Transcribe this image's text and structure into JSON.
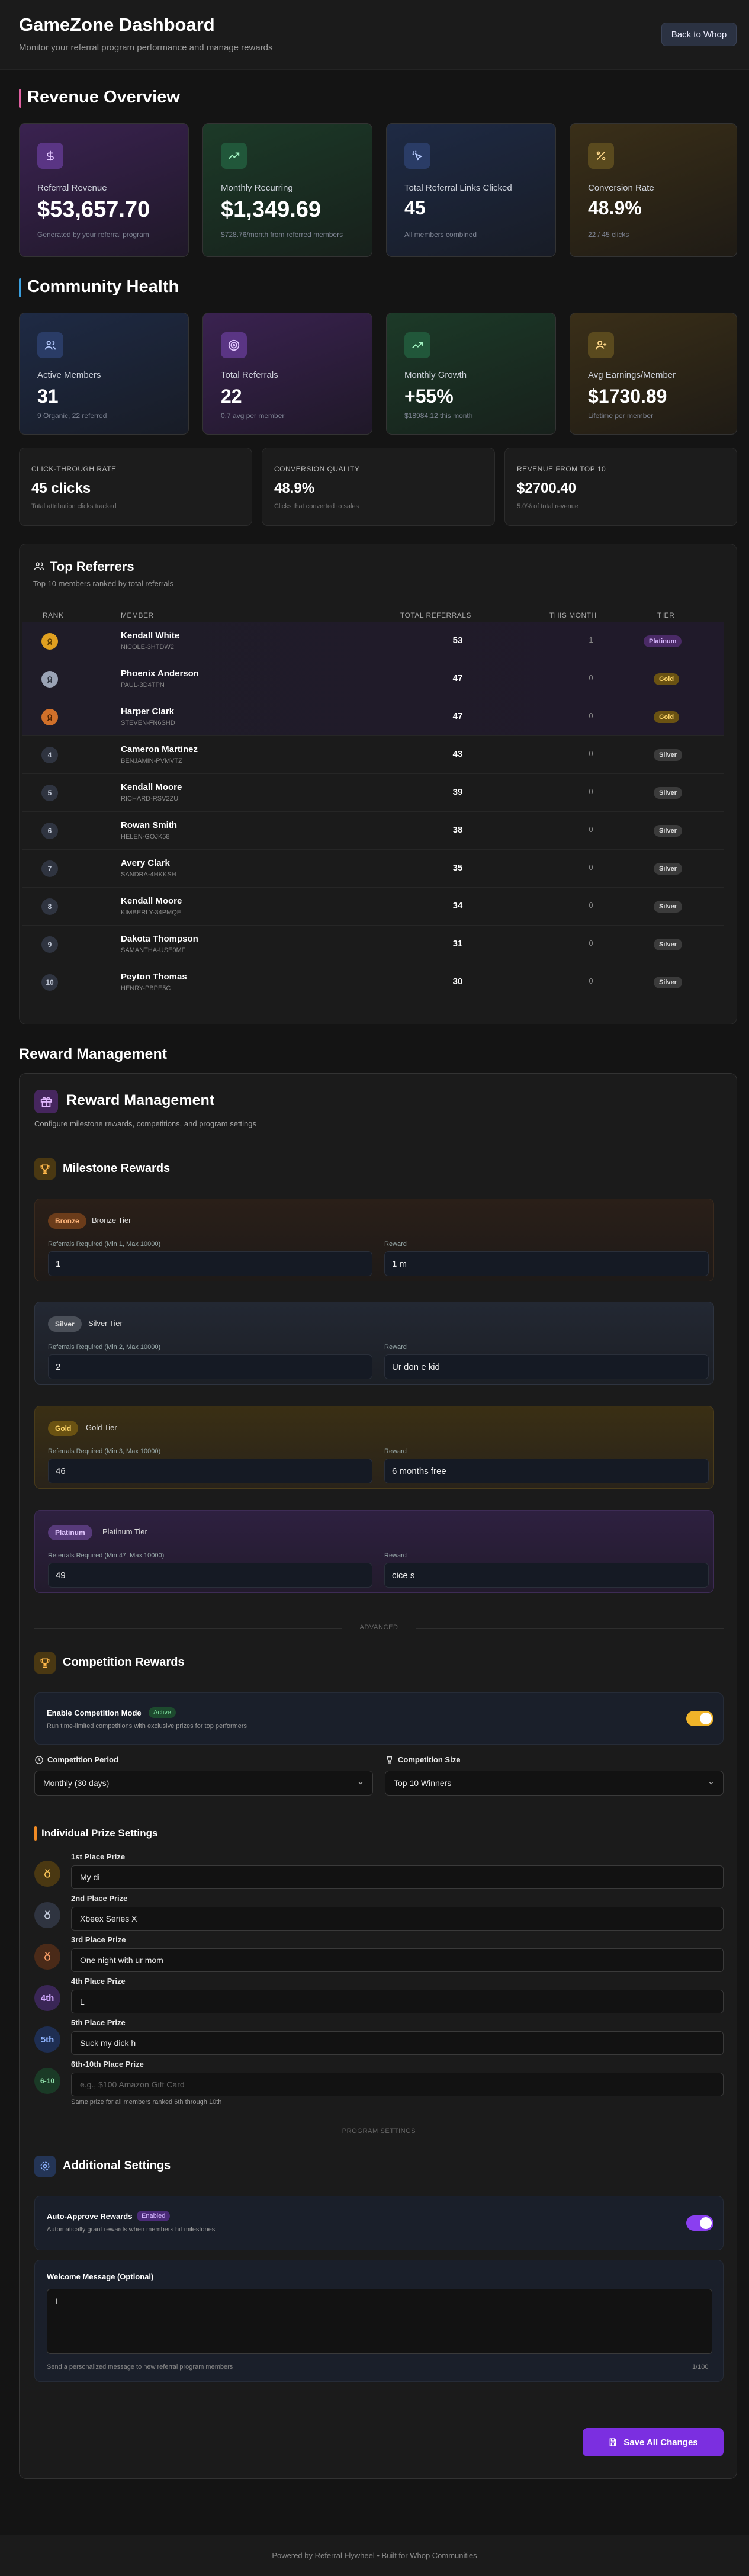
{
  "header": {
    "title": "GameZone Dashboard",
    "subtitle": "Monitor your referral program performance and manage rewards",
    "back_label": "Back to Whop"
  },
  "revenue": {
    "title": "Revenue Overview",
    "cards": [
      {
        "label": "Referral Revenue",
        "value": "$53,657.70",
        "sub": "Generated by your referral program",
        "icon": "dollar-icon"
      },
      {
        "label": "Monthly Recurring",
        "value": "$1,349.69",
        "sub": "$728.76/month from referred members",
        "icon": "trending-up-icon"
      },
      {
        "label": "Total Referral Links Clicked",
        "value": "45",
        "sub": "All members combined",
        "icon": "cursor-click-icon"
      },
      {
        "label": "Conversion Rate",
        "value": "48.9%",
        "sub": "22 / 45 clicks",
        "icon": "percent-icon"
      }
    ]
  },
  "community": {
    "title": "Community Health",
    "cards": [
      {
        "label": "Active Members",
        "value": "31",
        "sub": "9 Organic, 22 referred",
        "icon": "users-icon"
      },
      {
        "label": "Total Referrals",
        "value": "22",
        "sub": "0.7 avg per member",
        "icon": "target-icon"
      },
      {
        "label": "Monthly Growth",
        "value": "+55%",
        "sub": "$18984.12 this month",
        "icon": "trending-up-icon"
      },
      {
        "label": "Avg Earnings/Member",
        "value": "$1730.89",
        "sub": "Lifetime per member",
        "icon": "user-plus-icon"
      }
    ],
    "mini": [
      {
        "label": "Click-Through Rate",
        "value": "45 clicks",
        "sub": "Total attribution clicks tracked"
      },
      {
        "label": "Conversion Quality",
        "value": "48.9%",
        "sub": "Clicks that converted to sales"
      },
      {
        "label": "Revenue from Top 10",
        "value": "$2700.40",
        "sub": "5.0% of total revenue"
      }
    ]
  },
  "top": {
    "title": "Top Referrers",
    "subtitle": "Top 10 members ranked by total referrals",
    "columns": [
      "RANK",
      "MEMBER",
      "TOTAL REFERRALS",
      "THIS MONTH",
      "TIER"
    ],
    "rows": [
      {
        "rank": "1",
        "name": "Kendall White",
        "handle": "NICOLE-3HTDW2",
        "total": "53",
        "month": "1",
        "tier": "Platinum"
      },
      {
        "rank": "2",
        "name": "Phoenix Anderson",
        "handle": "PAUL-3D4TPN",
        "total": "47",
        "month": "0",
        "tier": "Gold"
      },
      {
        "rank": "3",
        "name": "Harper Clark",
        "handle": "STEVEN-FN6SHD",
        "total": "47",
        "month": "0",
        "tier": "Gold"
      },
      {
        "rank": "4",
        "name": "Cameron Martinez",
        "handle": "BENJAMIN-PVMVTZ",
        "total": "43",
        "month": "0",
        "tier": "Silver"
      },
      {
        "rank": "5",
        "name": "Kendall Moore",
        "handle": "RICHARD-RSV2ZU",
        "total": "39",
        "month": "0",
        "tier": "Silver"
      },
      {
        "rank": "6",
        "name": "Rowan Smith",
        "handle": "HELEN-GOJK58",
        "total": "38",
        "month": "0",
        "tier": "Silver"
      },
      {
        "rank": "7",
        "name": "Avery Clark",
        "handle": "SANDRA-4HKKSH",
        "total": "35",
        "month": "0",
        "tier": "Silver"
      },
      {
        "rank": "8",
        "name": "Kendall Moore",
        "handle": "KIMBERLY-34PMQE",
        "total": "34",
        "month": "0",
        "tier": "Silver"
      },
      {
        "rank": "9",
        "name": "Dakota Thompson",
        "handle": "SAMANTHA-USE0MF",
        "total": "31",
        "month": "0",
        "tier": "Silver"
      },
      {
        "rank": "10",
        "name": "Peyton Thomas",
        "handle": "HENRY-PBPE5C",
        "total": "30",
        "month": "0",
        "tier": "Silver"
      }
    ]
  },
  "reward": {
    "section_title": "Reward Management",
    "title": "Reward Management",
    "subtitle": "Configure milestone rewards, competitions, and program settings",
    "milestone_title": "Milestone Rewards",
    "tiers": [
      {
        "badge": "Bronze",
        "name": "Bronze Tier",
        "req_label": "Referrals Required (Min 1, Max 10000)",
        "req": "1",
        "reward_label": "Reward",
        "reward": "1 m"
      },
      {
        "badge": "Silver",
        "name": "Silver Tier",
        "req_label": "Referrals Required (Min 2, Max 10000)",
        "req": "2",
        "reward_label": "Reward",
        "reward": "Ur don e kid"
      },
      {
        "badge": "Gold",
        "name": "Gold Tier",
        "req_label": "Referrals Required (Min 3, Max 10000)",
        "req": "46",
        "reward_label": "Reward",
        "reward": "6 months free"
      },
      {
        "badge": "Platinum",
        "name": "Platinum Tier",
        "req_label": "Referrals Required (Min 47, Max 10000)",
        "req": "49",
        "reward_label": "Reward",
        "reward": "cice s"
      }
    ],
    "advanced_label": "ADVANCED",
    "competition": {
      "title": "Competition Rewards",
      "enable_label": "Enable Competition Mode",
      "status": "Active",
      "desc": "Run time-limited competitions with exclusive prizes for top performers",
      "period_label": "Competition Period",
      "period_value": "Monthly (30 days)",
      "size_label": "Competition Size",
      "size_value": "Top 10 Winners"
    },
    "prizes_title": "Individual Prize Settings",
    "prizes": [
      {
        "icon": "medal-gold-icon",
        "badge": "",
        "label": "1st Place Prize",
        "value": "My di",
        "placeholder": ""
      },
      {
        "icon": "medal-silver-icon",
        "badge": "",
        "label": "2nd Place Prize",
        "value": "Xbeex Series X",
        "placeholder": ""
      },
      {
        "icon": "medal-bronze-icon",
        "badge": "",
        "label": "3rd Place Prize",
        "value": "One night with ur mom",
        "placeholder": ""
      },
      {
        "icon": "",
        "badge": "4th",
        "label": "4th Place Prize",
        "value": "L",
        "placeholder": ""
      },
      {
        "icon": "",
        "badge": "5th",
        "label": "5th Place Prize",
        "value": "Suck my dick h",
        "placeholder": ""
      },
      {
        "icon": "",
        "badge": "6-10",
        "label": "6th-10th Place Prize",
        "value": "",
        "placeholder": "e.g., $100 Amazon Gift Card"
      }
    ],
    "prize_note": "Same prize for all members ranked 6th through 10th",
    "program_settings_label": "PROGRAM SETTINGS",
    "additional": {
      "title": "Additional Settings",
      "auto_label": "Auto-Approve Rewards",
      "auto_status": "Enabled",
      "auto_desc": "Automatically grant rewards when members hit milestones",
      "welcome_label": "Welcome Message (Optional)",
      "welcome_value": "I",
      "welcome_hint": "Send a personalized message to new referral program members",
      "counter": "1/100"
    },
    "save_label": "Save All Changes"
  },
  "footer": "Powered by Referral Flywheel • Built for Whop Communities",
  "colors": {
    "accent_purple": "#7b2fe0",
    "toggle_yellow": "#f0b429",
    "revenue_bar": "#e05fa0",
    "community_bar": "#3aa0e0",
    "prize_bar": "#f08a24"
  }
}
